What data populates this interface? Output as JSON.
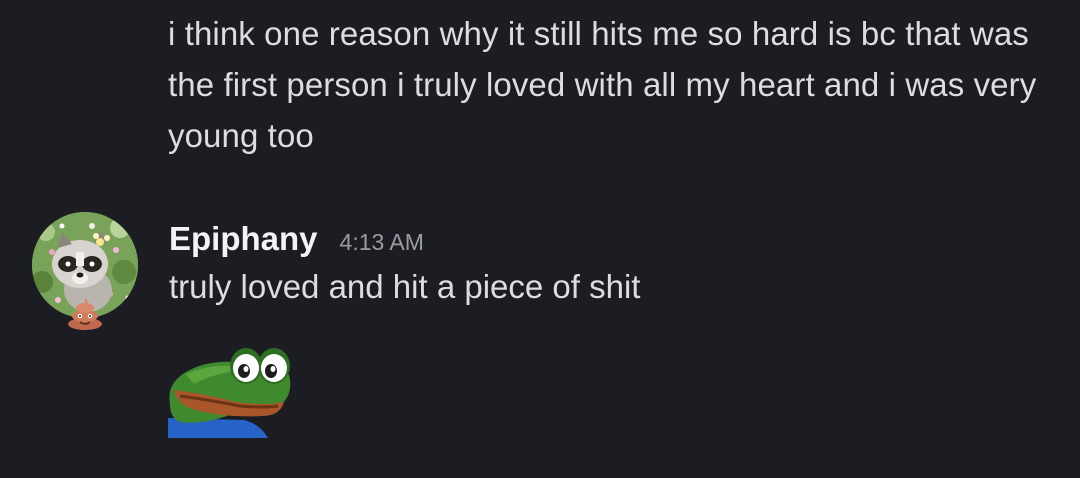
{
  "previous_message": {
    "text": "i think one reason why it still hits me so hard is bc that was the first person i truly loved with all my heart and i was very young too"
  },
  "message": {
    "username": "Epiphany",
    "timestamp": "4:13 AM",
    "text": "truly loved and hit a piece of shit",
    "avatar": "raccoon-avatar",
    "avatar_badge": "poop-emoji-icon",
    "sticker": "pepe-frog-peek-sticker"
  },
  "colors": {
    "background": "#1c1d22",
    "text": "#dcdde1",
    "username": "#f2f3f5",
    "timestamp": "#9a9ca3"
  }
}
